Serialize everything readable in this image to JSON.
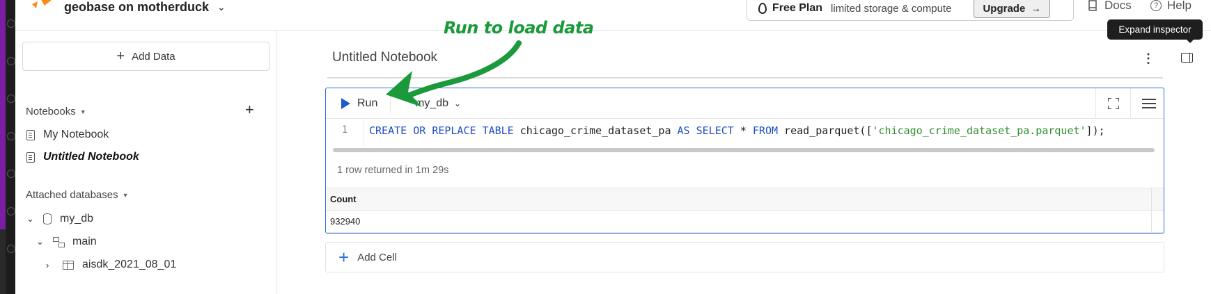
{
  "header": {
    "workspace_name": "geobase on motherduck",
    "plan_title": "Free Plan",
    "plan_subtitle": "limited storage & compute",
    "upgrade_label": "Upgrade",
    "upgrade_arrow": "→",
    "docs_label": "Docs",
    "help_label": "Help"
  },
  "sidebar": {
    "add_data_label": "Add Data",
    "notebooks_heading": "Notebooks",
    "notebooks": [
      {
        "label": "My Notebook"
      },
      {
        "label": "Untitled Notebook"
      }
    ],
    "databases_heading": "Attached databases",
    "tree": [
      {
        "label": "my_db"
      },
      {
        "label": "main"
      },
      {
        "label": "aisdk_2021_08_01"
      }
    ]
  },
  "main": {
    "notebook_title": "Untitled Notebook",
    "tooltip": "Expand inspector",
    "annotation": "Run to load data",
    "cell": {
      "run_label": "Run",
      "database": "my_db",
      "line_number": "1",
      "code_tokens": {
        "k1": "CREATE",
        "k2": "OR",
        "k3": "REPLACE",
        "k4": "TABLE",
        "t1": " chicago_crime_dataset_pa ",
        "k5": "AS",
        "k6": "SELECT",
        "t2": " * ",
        "k7": "FROM",
        "t3": " read_parquet([",
        "s1": "'chicago_crime_dataset_pa.parquet'",
        "t4": "]);"
      },
      "result_meta": "1 row returned in 1m 29s",
      "result_columns": [
        "Count"
      ],
      "result_rows": [
        [
          "932940"
        ]
      ]
    },
    "add_cell_label": "Add Cell"
  },
  "colors": {
    "accent": "#2f6fe0",
    "annotation": "#1a9a3a",
    "keyword": "#1f4fc4",
    "string": "#2f8f2f"
  }
}
